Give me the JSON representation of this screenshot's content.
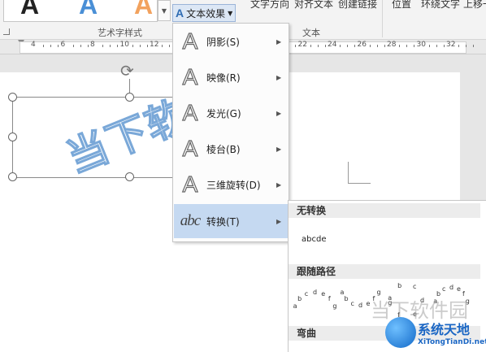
{
  "ribbon": {
    "gallery_letters": [
      {
        "char": "A",
        "color": "#111111"
      },
      {
        "char": "A",
        "color": "#4a8fd6"
      },
      {
        "char": "A",
        "color": "#f2a25e"
      }
    ],
    "text_effects_label": "文本效果",
    "text_direction_label": "文字方向",
    "align_text_label": "对齐文本",
    "create_link_label": "创建链接",
    "position_label": "位置",
    "wrap_text_label": "环绕文字",
    "bring_forward_label": "上移一",
    "wordart_styles_group": "艺术字样式",
    "text_group": "文本"
  },
  "ruler": {
    "numbers": [
      "4",
      "6",
      "8",
      "10",
      "12",
      "14",
      "16",
      "18",
      "20",
      "22",
      "24",
      "26",
      "28",
      "30",
      "32"
    ]
  },
  "document": {
    "wordart_text": "当下软件"
  },
  "text_effects_menu": {
    "items": [
      {
        "icon": "shadow-icon",
        "label": "阴影(S)"
      },
      {
        "icon": "reflection-icon",
        "label": "映像(R)"
      },
      {
        "icon": "glow-icon",
        "label": "发光(G)"
      },
      {
        "icon": "bevel-icon",
        "label": "棱台(B)"
      },
      {
        "icon": "3d-rotation-icon",
        "label": "三维旋转(D)"
      },
      {
        "icon": "transform-icon",
        "label": "转换(T)",
        "icon_text": "abc",
        "selected": true
      }
    ]
  },
  "transform_submenu": {
    "no_transform_heading": "无转换",
    "no_transform_sample": "abcde",
    "follow_path_heading": "跟随路径",
    "path_sample_text": "abcdefg",
    "warp_heading": "弯曲"
  },
  "watermark": {
    "text": "当下软件园",
    "logo_title": "系统天地",
    "logo_url": "XiTongTianDi.net"
  },
  "colors": {
    "accent": "#2f6cb3",
    "menu_selected": "#c5d9f1",
    "wordart_outline": "#7aa8d8"
  }
}
